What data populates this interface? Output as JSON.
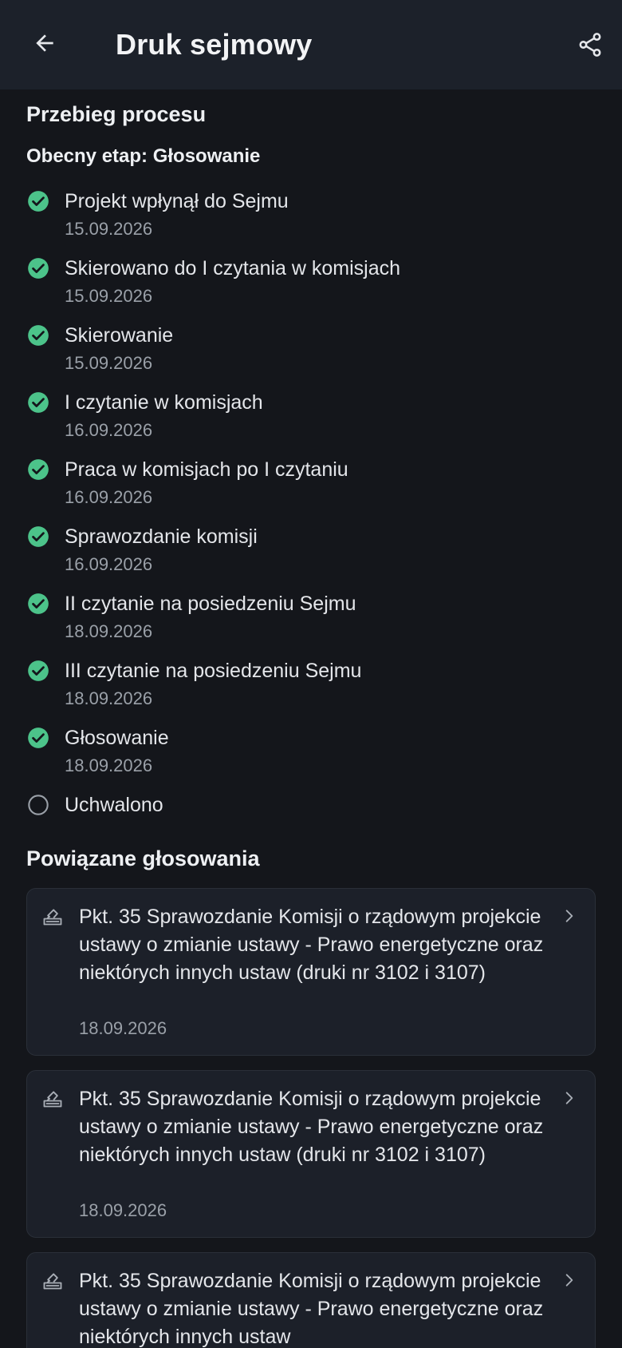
{
  "appbar": {
    "title": "Druk sejmowy",
    "back_icon": "arrow-left-icon",
    "share_icon": "share-icon"
  },
  "process": {
    "section_title": "Przebieg procesu",
    "current_stage": "Obecny etap: Głosowanie",
    "steps": [
      {
        "label": "Projekt wpłynął do Sejmu",
        "date": "15.09.2026",
        "done": true
      },
      {
        "label": "Skierowano do I czytania w komisjach",
        "date": "15.09.2026",
        "done": true
      },
      {
        "label": "Skierowanie",
        "date": "15.09.2026",
        "done": true
      },
      {
        "label": "I czytanie w komisjach",
        "date": "16.09.2026",
        "done": true
      },
      {
        "label": "Praca w komisjach po I czytaniu",
        "date": "16.09.2026",
        "done": true
      },
      {
        "label": "Sprawozdanie komisji",
        "date": "16.09.2026",
        "done": true
      },
      {
        "label": "II czytanie na posiedzeniu Sejmu",
        "date": "18.09.2026",
        "done": true
      },
      {
        "label": "III czytanie na posiedzeniu Sejmu",
        "date": "18.09.2026",
        "done": true
      },
      {
        "label": "Głosowanie",
        "date": "18.09.2026",
        "done": true
      },
      {
        "label": "Uchwalono",
        "date": "",
        "done": false
      }
    ]
  },
  "votes": {
    "section_title": "Powiązane głosowania",
    "items": [
      {
        "text": "Pkt. 35 Sprawozdanie Komisji o rządowym projekcie ustawy o zmianie ustawy - Prawo energetyczne oraz niektórych innych ustaw (druki nr 3102 i 3107)",
        "date": "18.09.2026"
      },
      {
        "text": "Pkt. 35 Sprawozdanie Komisji o rządowym projekcie ustawy o zmianie ustawy - Prawo energetyczne oraz niektórych innych ustaw (druki nr 3102 i 3107)",
        "date": "18.09.2026"
      },
      {
        "text": "Pkt. 35 Sprawozdanie Komisji o rządowym projekcie ustawy o zmianie ustawy - Prawo energetyczne oraz niektórych innych ustaw",
        "date": ""
      }
    ]
  },
  "colors": {
    "background": "#14161b",
    "appbar": "#1c212a",
    "check_green": "#4cc38a",
    "card": "#1c2029"
  }
}
